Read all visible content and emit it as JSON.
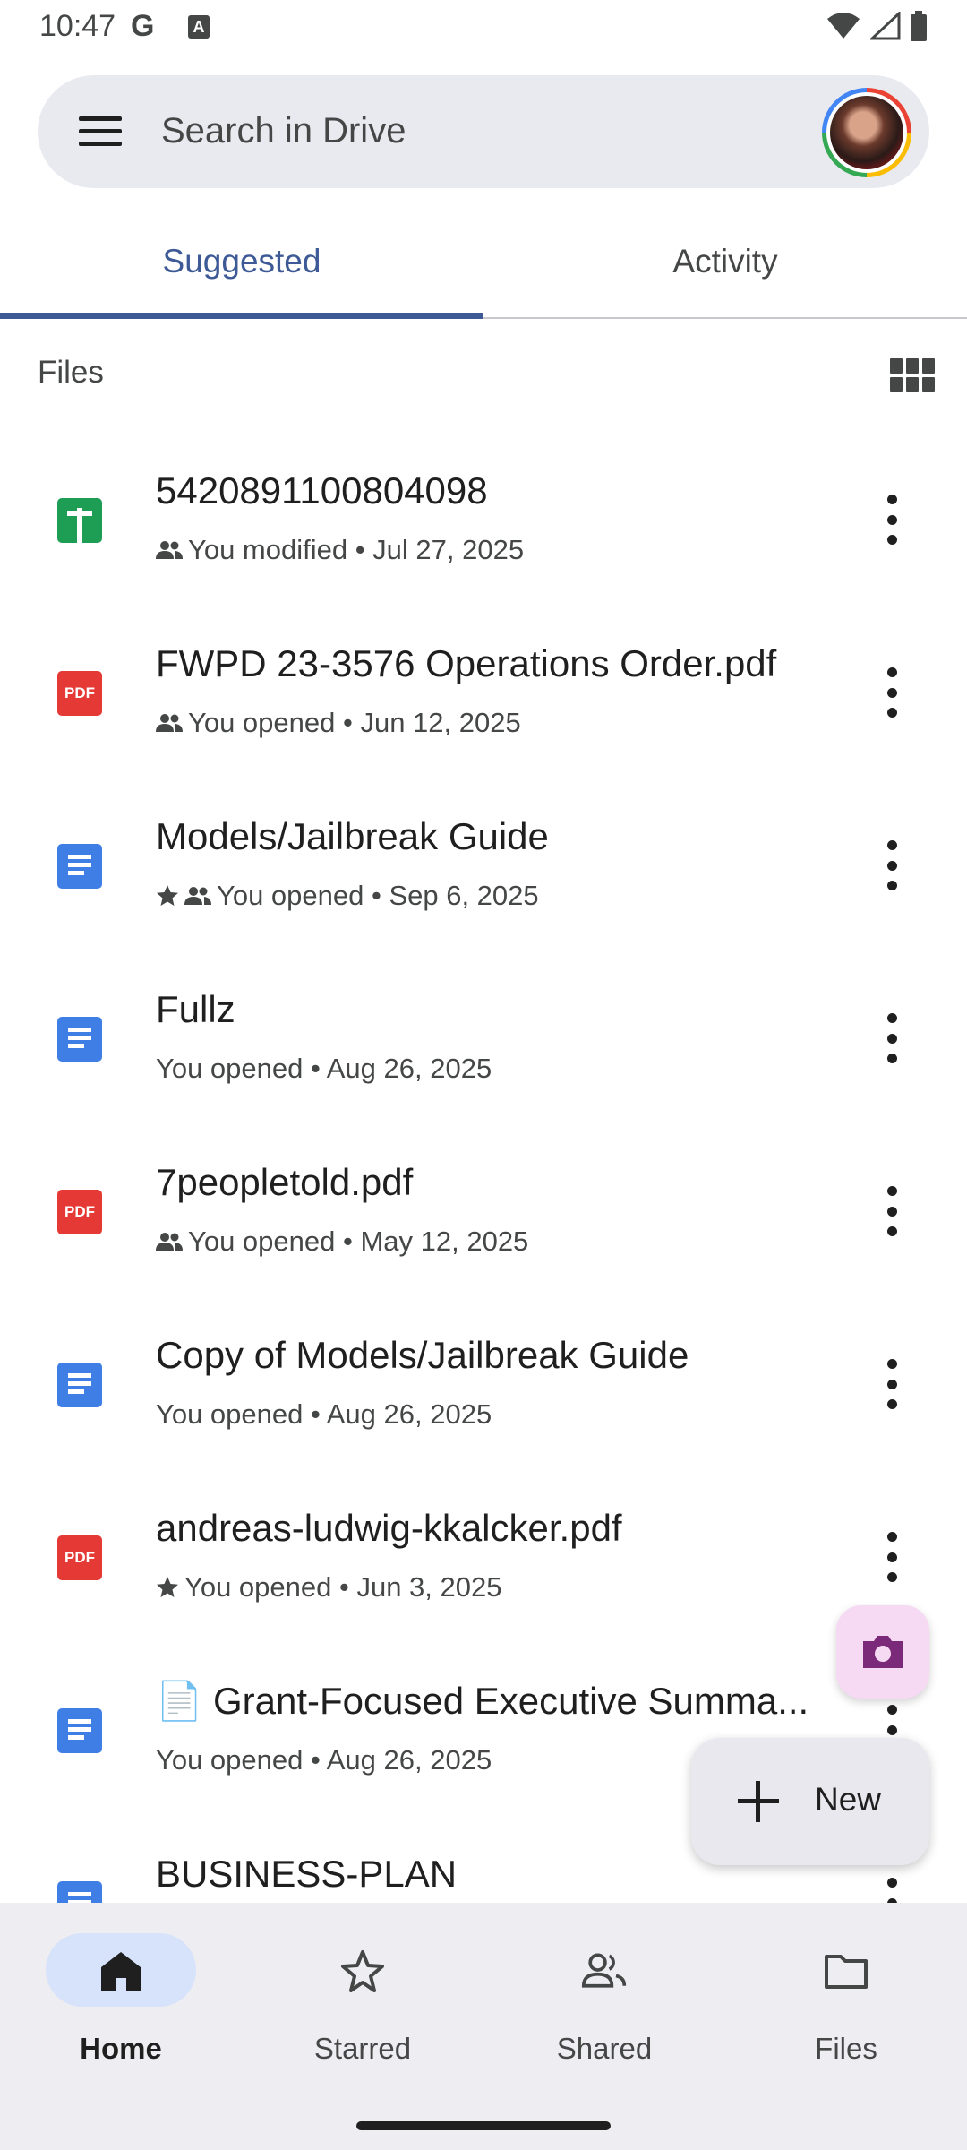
{
  "status_bar": {
    "time": "10:47",
    "g_glyph": "G",
    "a_glyph": "A",
    "icons": [
      "wifi-icon",
      "signal-icon",
      "battery-icon"
    ]
  },
  "search": {
    "placeholder": "Search in Drive"
  },
  "tabs": [
    {
      "label": "Suggested",
      "selected": true
    },
    {
      "label": "Activity",
      "selected": false
    }
  ],
  "files_section": {
    "title": "Files"
  },
  "files": [
    {
      "name": "5420891100804098",
      "type": "sheet",
      "starred": false,
      "shared": true,
      "meta": "You modified • Jul 27, 2025"
    },
    {
      "name": "FWPD 23-3576 Operations Order.pdf",
      "type": "pdf",
      "starred": false,
      "shared": true,
      "meta": "You opened • Jun 12, 2025"
    },
    {
      "name": "Models/Jailbreak Guide",
      "type": "doc",
      "starred": true,
      "shared": true,
      "meta": "You opened • Sep 6, 2025"
    },
    {
      "name": "Fullz",
      "type": "doc",
      "starred": false,
      "shared": false,
      "meta": "You opened • Aug 26, 2025"
    },
    {
      "name": "7peopletold.pdf",
      "type": "pdf",
      "starred": false,
      "shared": true,
      "meta": "You opened • May 12, 2025"
    },
    {
      "name": "Copy of Models/Jailbreak Guide",
      "type": "doc",
      "starred": false,
      "shared": false,
      "meta": "You opened • Aug 26, 2025"
    },
    {
      "name": "andreas-ludwig-kkalcker.pdf",
      "type": "pdf",
      "starred": true,
      "shared": false,
      "meta": "You opened • Jun 3, 2025"
    },
    {
      "name": "📄 Grant-Focused Executive Summa...",
      "type": "doc",
      "starred": false,
      "shared": false,
      "meta": "You opened • Aug 26, 2025"
    },
    {
      "name": "BUSINESS-PLAN",
      "type": "doc",
      "starred": false,
      "shared": false,
      "meta": ""
    }
  ],
  "pdf_badge": "PDF",
  "fab": {
    "new_label": "New",
    "camera_icon": "camera-icon"
  },
  "bottom_nav": [
    {
      "label": "Home",
      "icon": "home-icon",
      "active": true
    },
    {
      "label": "Starred",
      "icon": "star-icon",
      "active": false
    },
    {
      "label": "Shared",
      "icon": "people-icon",
      "active": false
    },
    {
      "label": "Files",
      "icon": "folder-icon",
      "active": false
    }
  ],
  "colors": {
    "accent": "#3d5a96",
    "sheet": "#1e9e54",
    "pdf": "#e53935",
    "doc": "#3f7fe5",
    "nav_active_pill": "#d7e2fb",
    "fab_camera": "#f6d9f3"
  }
}
